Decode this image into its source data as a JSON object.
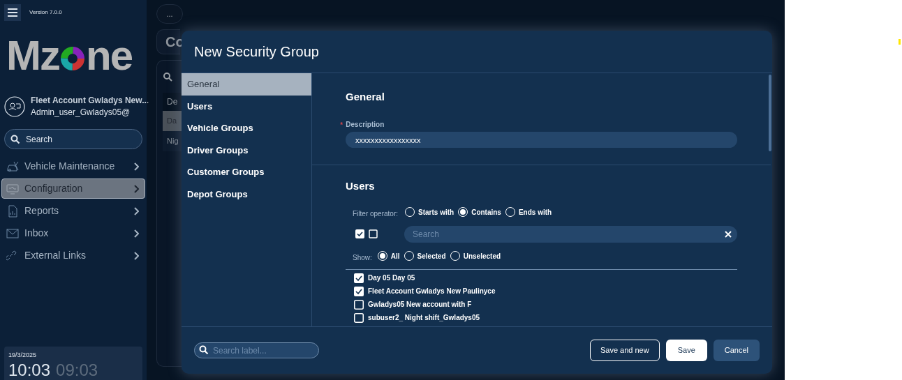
{
  "sidebar": {
    "version": "Version 7.0.0",
    "logo": {
      "before": "Mz",
      "after": "ne"
    },
    "account": {
      "name": "Fleet Account Gwladys New...",
      "user": "Admin_user_Gwladys05@"
    },
    "search": {
      "placeholder": "Search"
    },
    "items": [
      {
        "label": "Vehicle Maintenance",
        "selected": false
      },
      {
        "label": "Configuration",
        "selected": true
      },
      {
        "label": "Reports",
        "selected": false
      },
      {
        "label": "Inbox",
        "selected": false
      },
      {
        "label": "External Links",
        "selected": false
      }
    ],
    "clock": {
      "date": "19/3/2025",
      "local": "10:03",
      "other": "09:03"
    }
  },
  "background": {
    "more": "...",
    "title": "Co",
    "header": "De",
    "rows": [
      {
        "label": "Da",
        "selected": true
      },
      {
        "label": "Nig",
        "selected": false
      }
    ]
  },
  "modal": {
    "title": "New Security Group",
    "tabs": [
      {
        "label": "General",
        "selected": true
      },
      {
        "label": "Users",
        "selected": false
      },
      {
        "label": "Vehicle Groups",
        "selected": false
      },
      {
        "label": "Driver Groups",
        "selected": false
      },
      {
        "label": "Customer Groups",
        "selected": false
      },
      {
        "label": "Depot Groups",
        "selected": false
      }
    ],
    "general": {
      "heading": "General",
      "description": {
        "label": "Description",
        "required_mark": "*",
        "value": "xxxxxxxxxxxxxxxxx"
      }
    },
    "users": {
      "heading": "Users",
      "filter_label": "Filter operator:",
      "operators": [
        {
          "label": "Starts with",
          "selected": false
        },
        {
          "label": "Contains",
          "selected": true
        },
        {
          "label": "Ends with",
          "selected": false
        }
      ],
      "search": {
        "placeholder": "Search"
      },
      "show_label": "Show:",
      "show_options": [
        {
          "label": "All",
          "selected": true
        },
        {
          "label": "Selected",
          "selected": false
        },
        {
          "label": "Unselected",
          "selected": false
        }
      ],
      "items": [
        {
          "label": "Day 05 Day 05",
          "checked": true
        },
        {
          "label": "Fleet Account Gwladys New Paulinyce",
          "checked": true
        },
        {
          "label": "Gwladys05 New account with F",
          "checked": false
        },
        {
          "label": "subuser2_ Night shift_Gwladys05",
          "checked": false
        }
      ]
    },
    "footer": {
      "search": {
        "placeholder": "Search label..."
      },
      "buttons": [
        {
          "label": "Save and new",
          "kind": "outline"
        },
        {
          "label": "Save",
          "kind": "primary"
        },
        {
          "label": "Cancel",
          "kind": "secondary"
        }
      ]
    }
  }
}
